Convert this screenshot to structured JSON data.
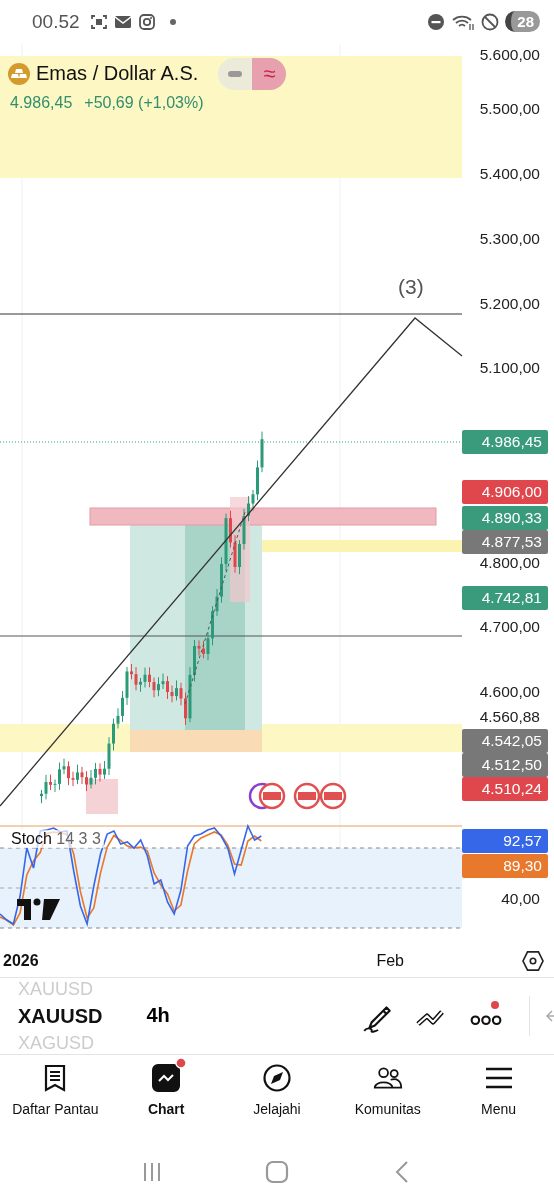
{
  "status_bar": {
    "time": "00.52",
    "battery": "28"
  },
  "symbol_header": {
    "title": "Emas / Dollar A.S.",
    "collapse_glyph": "≈",
    "price": "4.986,45",
    "change": "+50,69 (+1,03%)"
  },
  "chart": {
    "annotation": "(3)",
    "price_axis": [
      "5.600,00",
      "5.500,00",
      "5.400,00",
      "5.300,00",
      "5.200,00",
      "5.100,00",
      "4.800,00",
      "4.700,00",
      "4.600,00",
      "4.560,88"
    ],
    "price_tags": [
      {
        "label": "4.986,45",
        "color": "#3a9a7c"
      },
      {
        "label": "4.906,00",
        "color": "#e0474c"
      },
      {
        "label": "4.890,33",
        "color": "#3a9a7c"
      },
      {
        "label": "4.877,53",
        "color": "#787878"
      },
      {
        "label": "4.742,81",
        "color": "#3a9a7c"
      },
      {
        "label": "4.542,05",
        "color": "#787878"
      },
      {
        "label": "4.512,50",
        "color": "#787878"
      },
      {
        "label": "4.510,24",
        "color": "#e0474c"
      }
    ]
  },
  "stochastic": {
    "legend": "Stoch",
    "params": "14 3 3",
    "tags": [
      {
        "label": "92,57",
        "color": "#3567e8"
      },
      {
        "label": "89,30",
        "color": "#e8782c"
      }
    ],
    "axis": [
      "40,00"
    ]
  },
  "time_axis": [
    "2026",
    "Feb"
  ],
  "toolbar": {
    "symbols": [
      {
        "label": "XAUUSD",
        "selected": false
      },
      {
        "label": "XAUUSD",
        "selected": true
      },
      {
        "label": "XAGUSD",
        "selected": false
      }
    ],
    "interval": "4h",
    "more_badge": true
  },
  "nav": [
    {
      "label": "Daftar Pantau",
      "selected": false,
      "badge": false
    },
    {
      "label": "Chart",
      "selected": true,
      "badge": true
    },
    {
      "label": "Jelajahi",
      "selected": false,
      "badge": false
    },
    {
      "label": "Komunitas",
      "selected": false,
      "badge": false
    },
    {
      "label": "Menu",
      "selected": false,
      "badge": false
    }
  ]
}
